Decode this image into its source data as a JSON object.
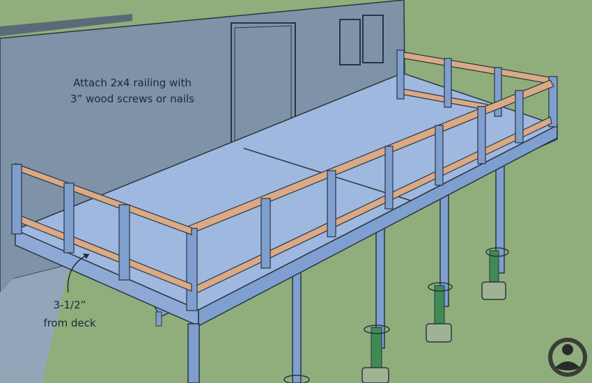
{
  "annotations": {
    "railing_instruction_line1": "Attach 2x4 railing with",
    "railing_instruction_line2": "3” wood screws or nails",
    "offset_line1": "3-1/2”",
    "offset_line2": "from deck"
  },
  "colors": {
    "grass": "#8fae7c",
    "house_wall": "#7e93a8",
    "deck_surface": "#9fb8e0",
    "deck_frame": "#7f9fd0",
    "rail_wood": "#d9aa85",
    "post": "#7f9fcf",
    "concrete": "#9fb293",
    "pier_green": "#3f8a55"
  },
  "logo": {
    "name": "mascot-logo"
  }
}
